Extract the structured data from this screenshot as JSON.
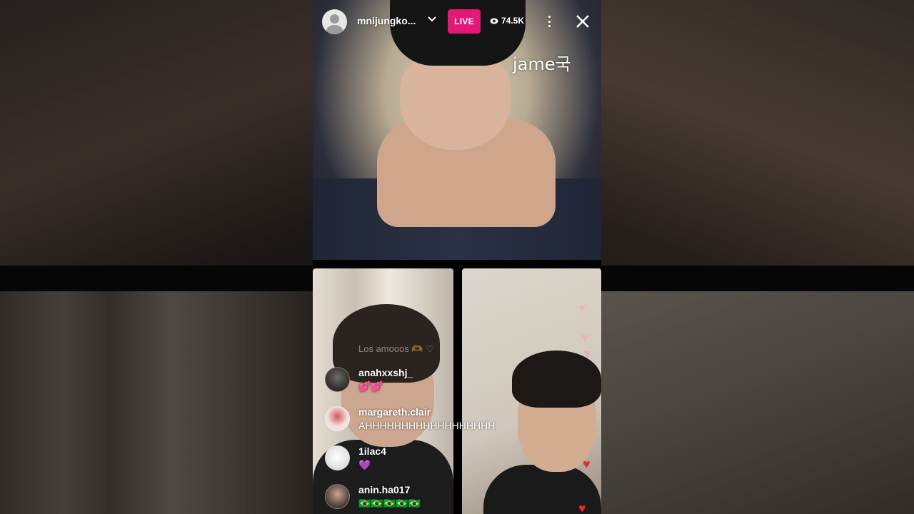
{
  "header": {
    "username": "mnijungko...",
    "live_label": "LIVE",
    "viewer_count": "74.5K"
  },
  "watermark": "jame국",
  "fading_comment": "Los amooos 🫶 ♡",
  "comments": [
    {
      "username": "anahxxshj_",
      "text": "💕💕"
    },
    {
      "username": "margareth.clair",
      "text": "AHHHHHHHHHHHHHHHHHH"
    },
    {
      "username": "1ilac4",
      "text": "💜"
    },
    {
      "username": "anin.ha017",
      "text": "🇧🇷🇧🇷🇧🇷🇧🇷🇧🇷"
    }
  ],
  "colors": {
    "live_badge": "#e3197a",
    "heart_red": "#e8262f",
    "heart_pink": "#f4a3b0"
  },
  "icons": [
    "profile-placeholder-icon",
    "chevron-down-icon",
    "eye-icon",
    "more-options-icon",
    "close-icon",
    "heart-icon"
  ]
}
